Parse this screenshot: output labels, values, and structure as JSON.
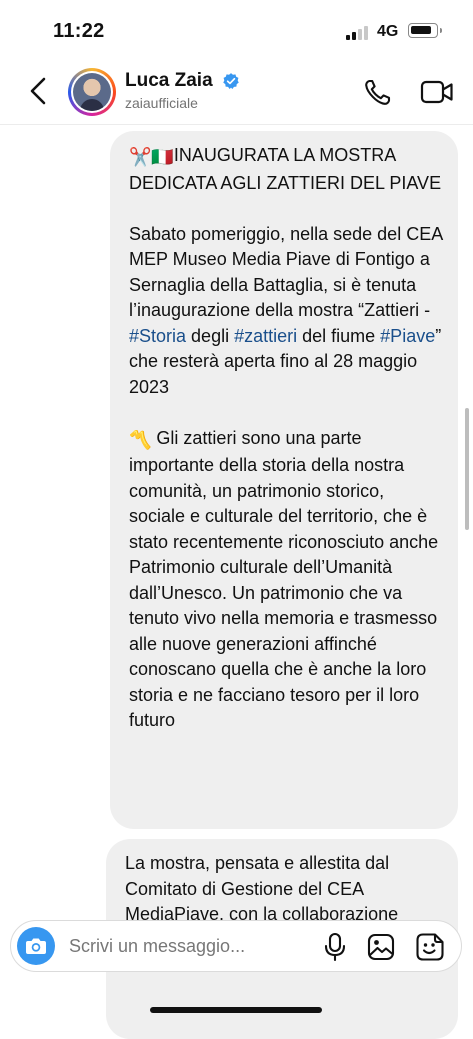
{
  "status_bar": {
    "time": "11:22",
    "network": "4G",
    "signal_bars_active": 2,
    "signal_bars_total": 4,
    "battery_level": 0.85
  },
  "header": {
    "name": "Luca Zaia",
    "handle": "zaiaufficiale",
    "verified": true
  },
  "messages": {
    "m1": {
      "p1": {
        "text": "INAUGURATA LA MOSTRA DEDICATA AGLI ZATTIERI DEL PIAVE",
        "emojis": [
          "✂️",
          "🇮🇹"
        ]
      },
      "p2": {
        "t1": "Sabato pomeriggio, nella sede del CEA MEP Museo Media Piave di Fontigo a Sernaglia della Battaglia, si è tenuta l’inaugurazione della mostra “Zattieri - ",
        "tag1": "#Storia",
        "t2": " degli ",
        "tag2": "#zattieri",
        "t3": " del fiume ",
        "tag3": "#Piave",
        "t4": "” che resterà aperta fino al 28 maggio 2023"
      },
      "p3": {
        "emoji": "〽️",
        "text": " Gli zattieri sono una parte importante della storia della nostra comunità, un patrimonio storico, sociale e culturale del territorio, che è stato recentemente riconosciuto anche Patrimonio culturale dell’Umanità dall’Unesco. Un patrimonio che va tenuto vivo nella memoria e trasmesso alle nuove generazioni affinché conoscano quella che è anche la loro storia e ne facciano tesoro per il loro futuro"
      }
    },
    "m2": {
      "text": "La mostra, pensata e allestita dal Comitato di Gestione del CEA MediaPiave, con la collaborazione"
    }
  },
  "composer": {
    "placeholder": "Scrivi un messaggio..."
  },
  "colors": {
    "accent": "#3797f0",
    "bubble": "#efefef",
    "hashtag": "#1a4f8b",
    "verified": "#3897f0"
  },
  "icons": [
    "back-icon",
    "verified-icon",
    "phone-icon",
    "video-camera-icon",
    "camera-icon",
    "microphone-icon",
    "gallery-icon",
    "sticker-icon"
  ]
}
